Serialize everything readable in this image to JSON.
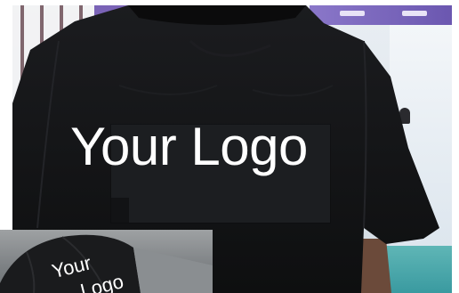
{
  "shirt_print": {
    "text": "Your Logo"
  },
  "cap_print": {
    "line1": "Your",
    "line2": "Logo"
  },
  "colors": {
    "shirt": "#131416",
    "print_plate": "#1c1e21",
    "print_text": "#ffffff",
    "background": "#e3e9ee",
    "banner": "#7a63b6"
  }
}
